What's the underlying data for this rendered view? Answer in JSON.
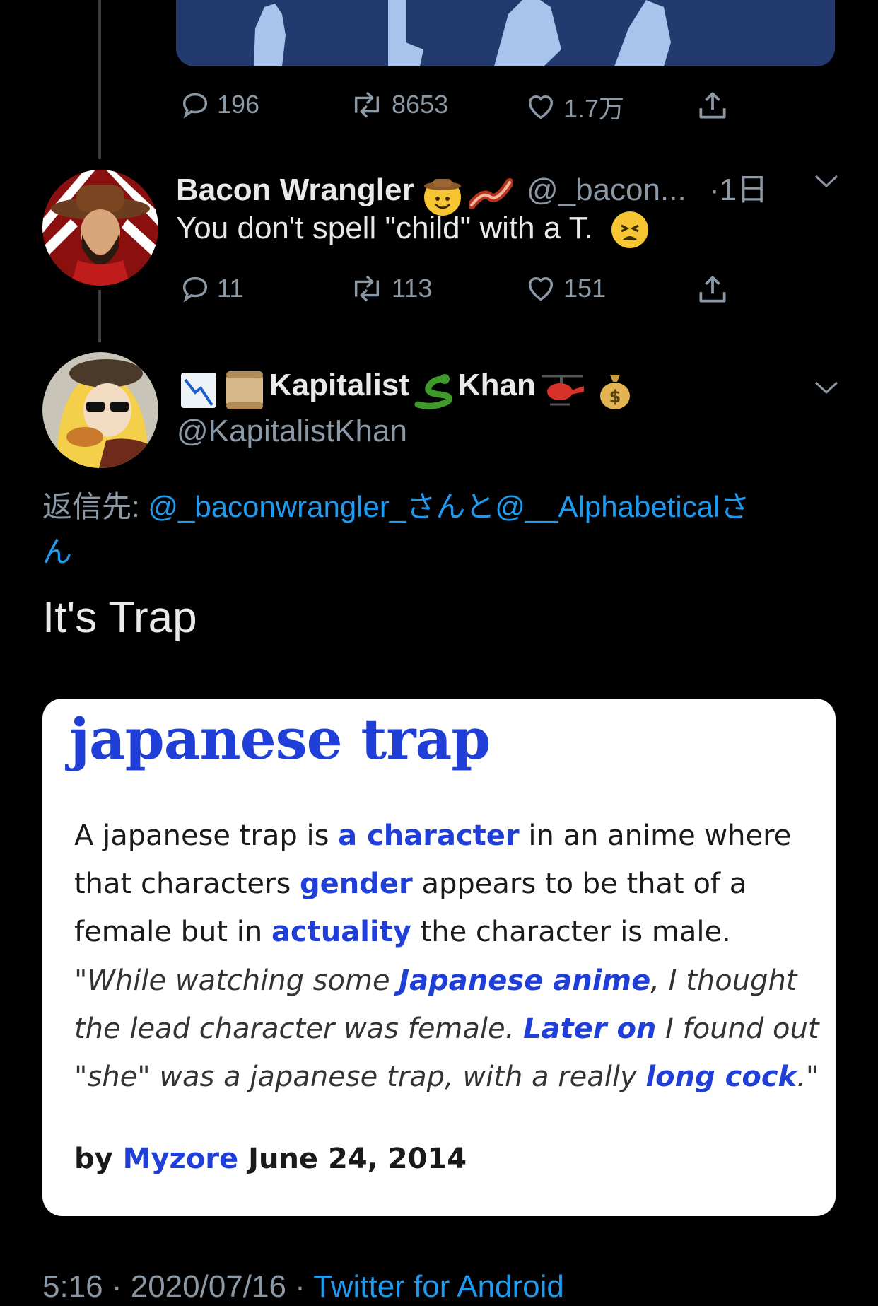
{
  "previous_tweet": {
    "actions": {
      "reply_count": "196",
      "retweet_count": "8653",
      "like_count": "1.7万"
    }
  },
  "reply_tweet": {
    "display_name": "Bacon Wrangler",
    "handle": "@_bacon...",
    "time": "·1日",
    "text": "You don't spell \"child\" with a T.",
    "actions": {
      "reply_count": "11",
      "retweet_count": "113",
      "like_count": "151"
    }
  },
  "main_tweet": {
    "name_part1": "Kapitalist",
    "name_part2": "Khan",
    "handle": "@KapitalistKhan",
    "reply_to_label": "返信先:",
    "reply_to_text": "@_baconwrangler_さんと@__Alphabeticalさ",
    "reply_to_text_line2": "ん",
    "text": "It's Trap",
    "card": {
      "title": "japanese trap",
      "def_1": "A japanese trap is ",
      "def_link_1": "a character",
      "def_2": " in an anime where that characters ",
      "def_link_2": "gender",
      "def_3": " appears to be that of a female but in ",
      "def_link_3": "actuality",
      "def_4": " the character is male.",
      "ex_1": "\"While watching some ",
      "ex_link_1": "Japanese anime",
      "ex_2": ", I thought the lead character was female. ",
      "ex_link_2": "Later on",
      "ex_3": " I found out \"she\" was a japanese trap, with a really ",
      "ex_link_3": "long cock",
      "ex_4": ".\"",
      "by_label": "by",
      "author": "Myzore",
      "date": "June 24, 2014"
    },
    "footer_time": "5:16 · 2020/07/16 · ",
    "footer_client": "Twitter for Android"
  },
  "icons": [
    "reply-icon",
    "retweet-icon",
    "like-icon",
    "share-icon",
    "chevron-down-icon"
  ],
  "colors": {
    "background": "#000000",
    "link": "#1d9bf0",
    "muted": "#8b98a5",
    "ud_blue": "#1f3fd8"
  }
}
